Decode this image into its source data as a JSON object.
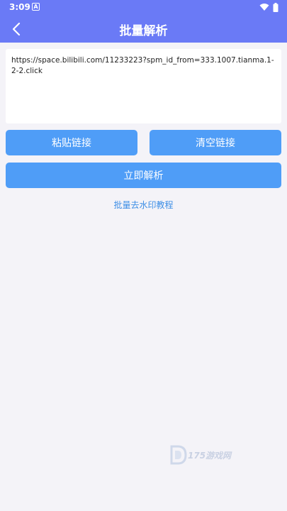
{
  "status": {
    "time": "3:09",
    "notif_glyph": "A"
  },
  "header": {
    "title": "批量解析"
  },
  "input": {
    "value": "https://space.bilibili.com/11233223?spm_id_from=333.1007.tianma.1-2-2.click"
  },
  "buttons": {
    "paste": "粘贴链接",
    "clear": "清空链接",
    "parse": "立即解析"
  },
  "tutorial": {
    "label": "批量去水印教程"
  },
  "watermark": {
    "text": "175游戏网"
  },
  "colors": {
    "header": "#6a7af6",
    "button": "#4f9df7",
    "link": "#3e8fe6",
    "background": "#f4f3f8"
  }
}
